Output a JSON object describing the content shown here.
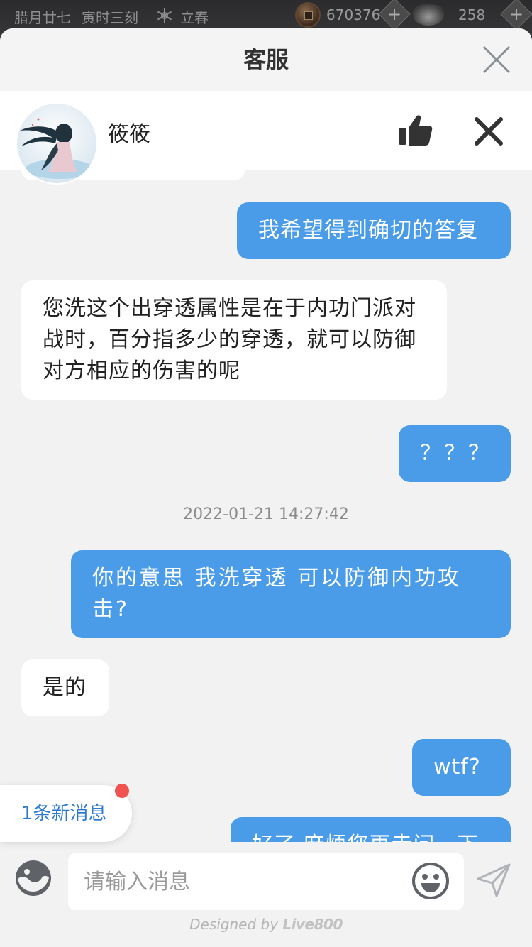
{
  "game_bar": {
    "date": "腊月廿七",
    "time": "寅时三刻",
    "season_icon": "snowflake-icon",
    "season": "立春",
    "coins": "670376",
    "ingots": "258"
  },
  "modal": {
    "title": "客服"
  },
  "agent": {
    "name": "筱筱"
  },
  "messages": [
    {
      "from": "me",
      "text": "我希望得到确切的答复"
    },
    {
      "from": "agent",
      "text": "您洗这个出穿透属性是在于内功门派对战时，百分指多少的穿透，就可以防御对方相应的伤害的呢"
    },
    {
      "from": "me",
      "text": "？？？"
    },
    {
      "from": "me",
      "text": "你的意思 我洗穿透 可以防御内功攻击?"
    },
    {
      "from": "agent",
      "text": "是的"
    },
    {
      "from": "me",
      "text": "wtf?"
    },
    {
      "from": "me",
      "text": "好了 麻烦您再走问一下"
    }
  ],
  "timestamp": "2022-01-21 14:27:42",
  "new_message_label": "1条新消息",
  "input": {
    "placeholder": "请输入消息"
  },
  "footer": {
    "prefix": "Designed by",
    "brand": "Live800"
  },
  "colors": {
    "outgoing_bubble": "#4a9be8",
    "incoming_bubble": "#ffffff",
    "chat_background": "#f2f2f2",
    "badge": "#f0524f",
    "link": "#2e7ad1"
  }
}
